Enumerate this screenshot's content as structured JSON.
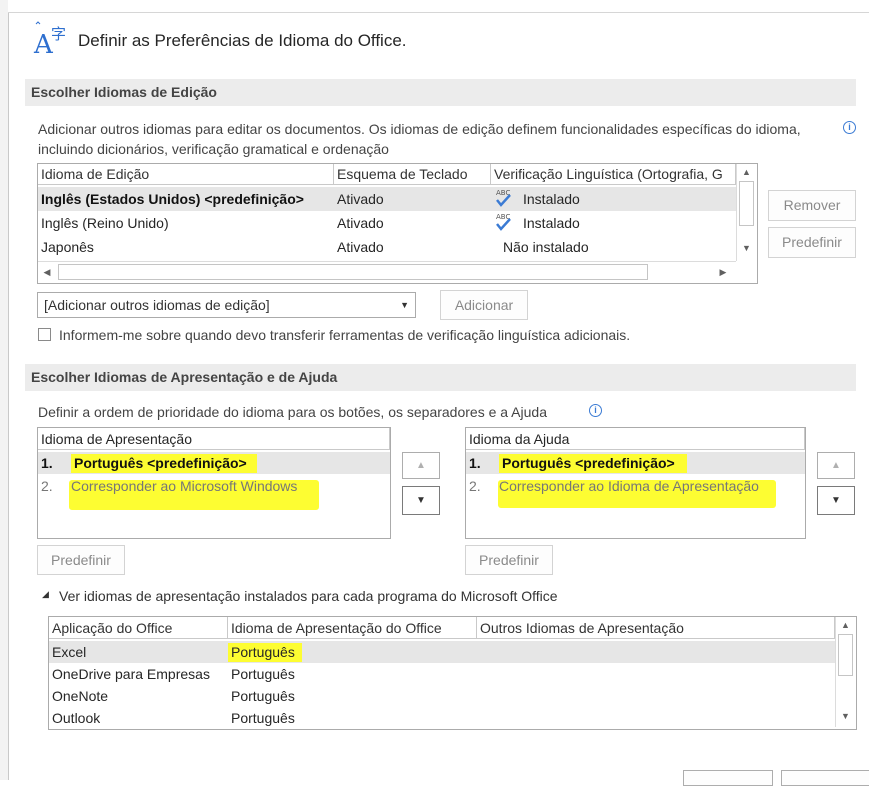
{
  "dialog": {
    "title": "Definir as Preferências de Idioma do Office."
  },
  "editing": {
    "section_title": "Escolher Idiomas de Edição",
    "description": "Adicionar outros idiomas para editar os documentos. Os idiomas de edição definem funcionalidades específicas do idioma, incluindo dicionários, verificação gramatical e ordenação",
    "columns": [
      "Idioma de Edição",
      "Esquema de Teclado",
      "Verificação Linguística (Ortografia, G"
    ],
    "rows": [
      {
        "language": "Inglês (Estados Unidos) <predefinição>",
        "keyboard": "Ativado",
        "proofing": "Instalado"
      },
      {
        "language": "Inglês (Reino Unido)",
        "keyboard": "Ativado",
        "proofing": "Instalado"
      },
      {
        "language": "Japonês",
        "keyboard": "Ativado",
        "proofing": "Não instalado"
      }
    ],
    "abc_label": "ABC",
    "remove_label": "Remover",
    "set_default_label": "Predefinir",
    "add_combo_value": "[Adicionar outros idiomas de edição]",
    "add_label": "Adicionar",
    "notify_checkbox_label": "Informem-me sobre quando devo transferir ferramentas de verificação linguística adicionais."
  },
  "display": {
    "section_title": "Escolher Idiomas de Apresentação e de Ajuda",
    "description": "Definir a ordem de prioridade do idioma para os botões, os separadores e a Ajuda",
    "display_list": {
      "header": "Idioma de Apresentação",
      "items": [
        {
          "num": "1.",
          "label": "Português <predefinição>"
        },
        {
          "num": "2.",
          "label": "Corresponder ao Microsoft Windows"
        }
      ]
    },
    "help_list": {
      "header": "Idioma da Ajuda",
      "items": [
        {
          "num": "1.",
          "label": "Português <predefinição>"
        },
        {
          "num": "2.",
          "label": "Corresponder ao Idioma de Apresentação"
        }
      ]
    },
    "set_default_label": "Predefinir",
    "expander_label": "Ver idiomas de apresentação instalados para cada programa do Microsoft Office",
    "apps_columns": [
      "Aplicação do Office",
      "Idioma de Apresentação do Office",
      "Outros Idiomas de Apresentação"
    ],
    "apps_rows": [
      {
        "app": "Excel",
        "language": "Português",
        "other": ""
      },
      {
        "app": "OneDrive para Empresas",
        "language": "Português",
        "other": ""
      },
      {
        "app": "OneNote",
        "language": "Português",
        "other": ""
      },
      {
        "app": "Outlook",
        "language": "Português",
        "other": ""
      }
    ]
  },
  "colors": {
    "highlight": "#fdfd32",
    "section_bg": "#ececec",
    "selected_row": "#e6e6e6",
    "check_blue": "#3b7bd4"
  }
}
